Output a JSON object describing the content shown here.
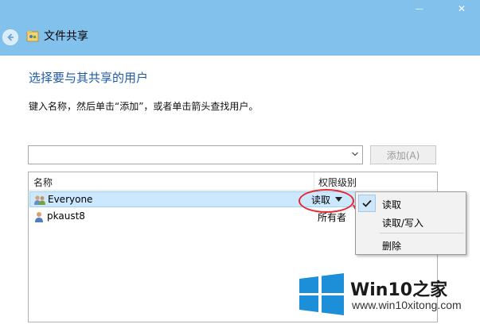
{
  "window": {
    "title": "文件共享",
    "minimize_glyph": "—",
    "close_glyph": "✕"
  },
  "page": {
    "heading": "选择要与其共享的用户",
    "instruction": "键入名称，然后单击“添加”，或者单击箭头查找用户。"
  },
  "picker": {
    "value": "",
    "add_label": "添加(A)"
  },
  "list": {
    "columns": [
      "名称",
      "权限级别"
    ],
    "rows": [
      {
        "name": "Everyone",
        "permission": "读取",
        "icon": "group-users-icon",
        "selected": true
      },
      {
        "name": "pkaust8",
        "permission": "所有者",
        "icon": "user-icon",
        "selected": false
      }
    ]
  },
  "context_menu": {
    "items": [
      {
        "label": "读取",
        "checked": true
      },
      {
        "label": "读取/写入",
        "checked": false
      },
      {
        "label": "删除",
        "checked": false
      }
    ]
  },
  "watermark": {
    "brand": "Win10之家",
    "url": "www.win10xitong.com"
  },
  "colors": {
    "titlebar": "#82c1eb",
    "heading": "#1e5aa8",
    "selection": "#cce8ff",
    "annotation": "#e8282c",
    "logo_blue": "#1d8fd8"
  }
}
